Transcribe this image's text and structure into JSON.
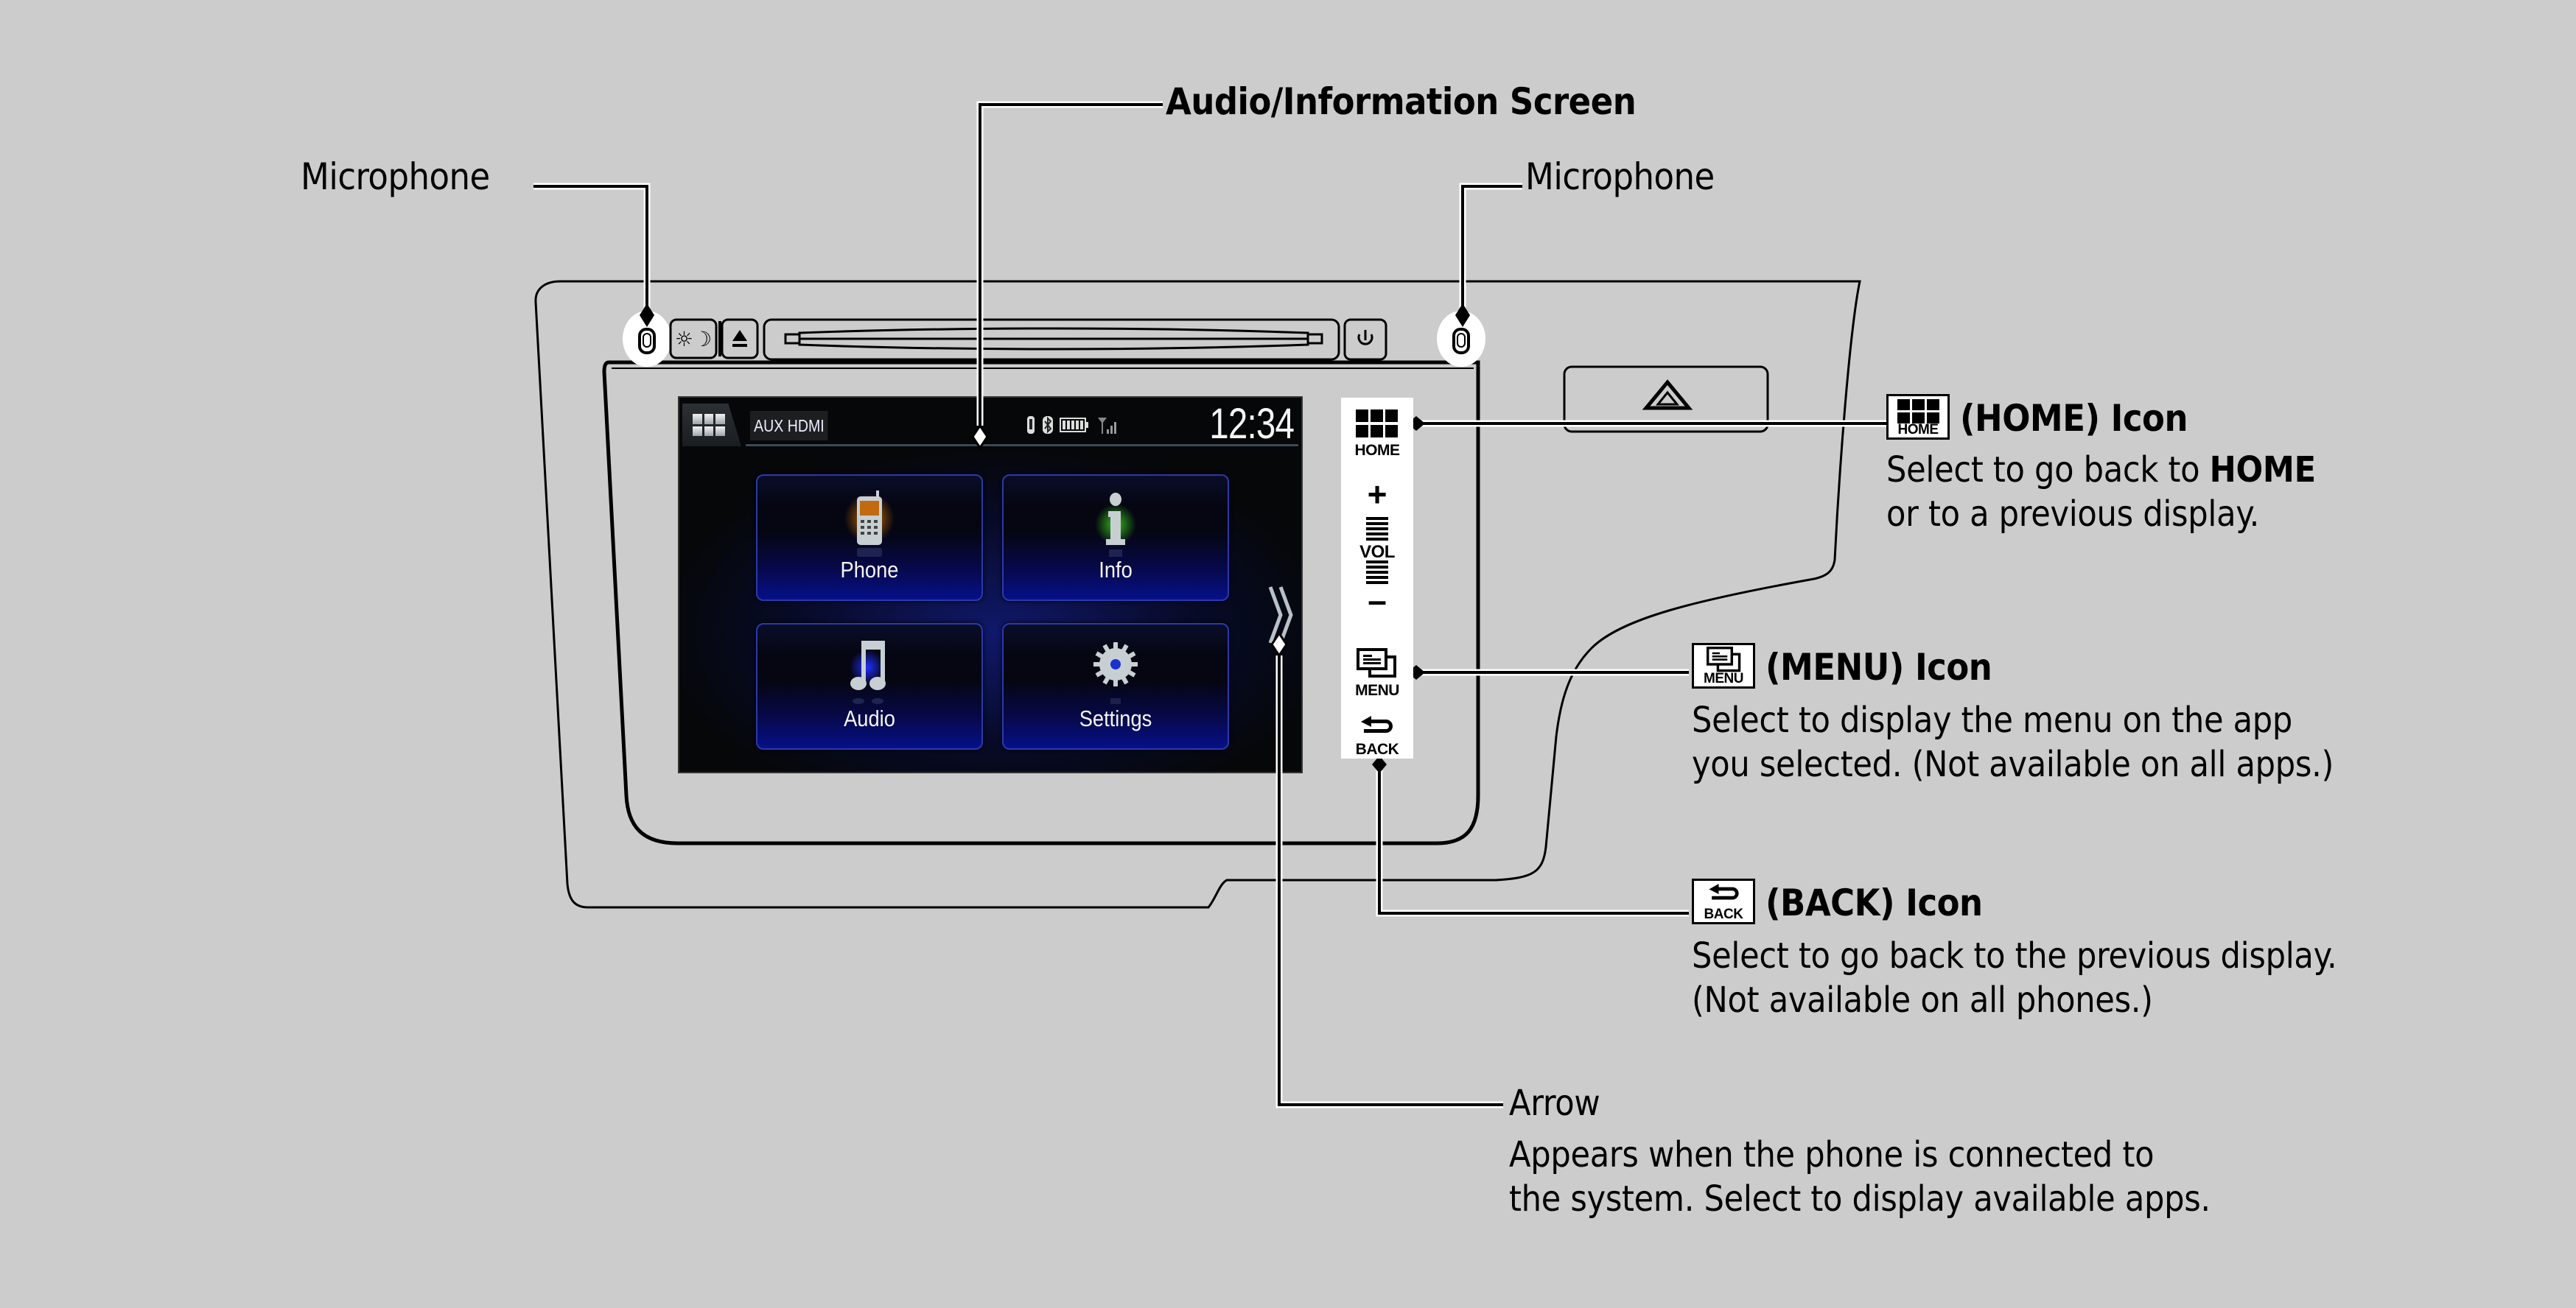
{
  "callouts": {
    "microphone_left": "Microphone",
    "audio_info_screen": "Audio/Information Screen",
    "microphone_right": "Microphone",
    "home": {
      "title": "(HOME) Icon",
      "icon_caption": "HOME",
      "desc_line1_prefix": "Select to go back to ",
      "desc_line1_bold": "HOME",
      "desc_line2": "or to a previous display."
    },
    "menu": {
      "title": "(MENU) Icon",
      "icon_caption": "MENU",
      "desc_line1": "Select to display the menu on the app",
      "desc_line2": "you selected. (Not available on all apps.)"
    },
    "back": {
      "title": "(BACK) Icon",
      "icon_caption": "BACK",
      "desc_line1": "Select to go back to the previous display.",
      "desc_line2": "(Not available on all phones.)"
    },
    "arrow": {
      "title": "Arrow",
      "desc_line1": "Appears when the phone is connected to",
      "desc_line2": "the system. Select to display available apps."
    }
  },
  "head_unit": {
    "top_buttons": [
      {
        "name": "day-night",
        "icon": "sun-moon-icon"
      },
      {
        "name": "eject",
        "icon": "eject-icon"
      },
      {
        "name": "disc-slot",
        "icon": "disc-slot"
      },
      {
        "name": "power",
        "icon": "power-icon"
      }
    ],
    "hazard_icon": "hazard-triangle-icon",
    "side_buttons": {
      "home": "HOME",
      "vol_plus": "+",
      "vol": "VOL",
      "vol_minus": "–",
      "menu": "MENU",
      "back": "BACK"
    }
  },
  "screen": {
    "source": "AUX HDMI",
    "clock": "12:34",
    "status_icons": [
      "usb-icon",
      "bluetooth-icon",
      "battery-icon",
      "signal-icon"
    ],
    "tiles": [
      {
        "label": "Phone",
        "icon": "phone-icon"
      },
      {
        "label": "Info",
        "icon": "info-icon"
      },
      {
        "label": "Audio",
        "icon": "music-note-icon"
      },
      {
        "label": "Settings",
        "icon": "gear-icon"
      }
    ]
  }
}
